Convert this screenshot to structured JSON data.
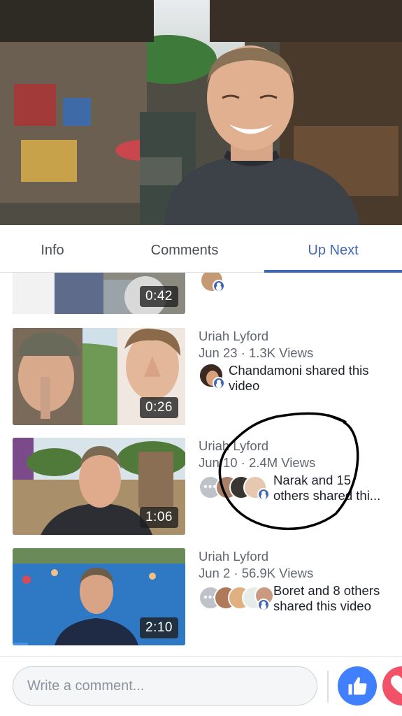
{
  "player": {
    "scene": "floating-market-host-smiling"
  },
  "tabs": [
    {
      "label": "Info",
      "active": false
    },
    {
      "label": "Comments",
      "active": false
    },
    {
      "label": "Up Next",
      "active": true
    }
  ],
  "colors": {
    "accent": "#4267b2",
    "like": "#4080ff",
    "love": "#f25268",
    "annotation": "#000000"
  },
  "up_next": [
    {
      "duration": "0:42",
      "author": "",
      "stats": "",
      "shared_text": ""
    },
    {
      "duration": "0:26",
      "author": "Uriah Lyford",
      "stats": "Jun 23 · 1.3K Views",
      "shared_line1": "Chandamoni shared this",
      "shared_line2": "video"
    },
    {
      "duration": "1:06",
      "author": "Uriah Lyford",
      "stats": "Jun 10 · 2.4M Views",
      "shared_line1": "Narak and 15",
      "shared_line2": "others shared thi..."
    },
    {
      "duration": "2:10",
      "author": "Uriah Lyford",
      "stats": "Jun 2 · 56.9K Views",
      "shared_line1": "Boret and 8 others",
      "shared_line2": "shared this video"
    }
  ],
  "comment_box": {
    "placeholder": "Write a comment..."
  },
  "icons": {
    "like": "thumbs-up-icon",
    "love": "heart-icon",
    "more_avatars": "more-dots-icon",
    "share_badge": "person-badge-icon"
  }
}
